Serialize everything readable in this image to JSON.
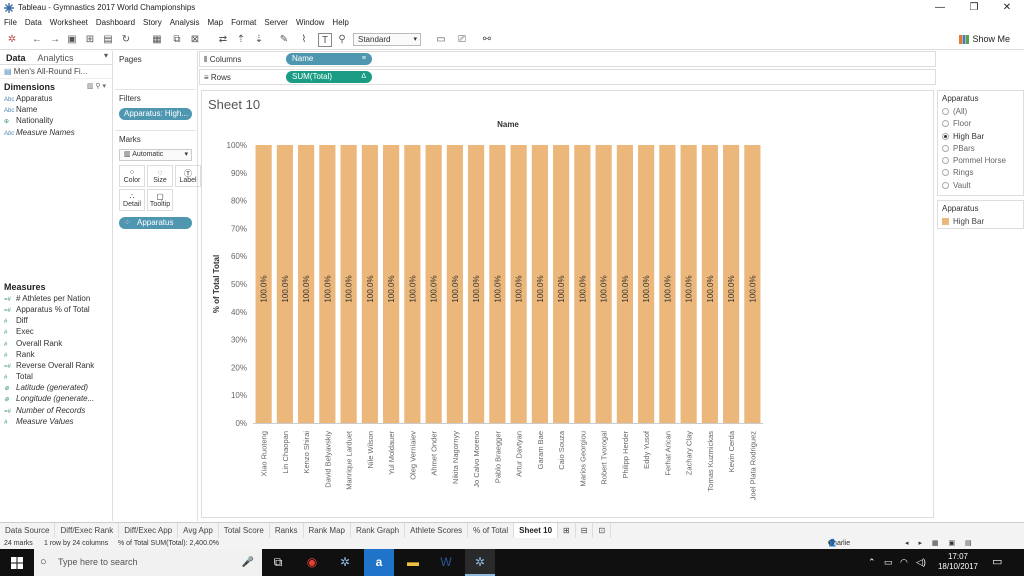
{
  "window": {
    "title": "Tableau - Gymnastics 2017 World Championships",
    "minimize": "—",
    "maximize": "❐",
    "close": "✕"
  },
  "menu": [
    "File",
    "Data",
    "Worksheet",
    "Dashboard",
    "Story",
    "Analysis",
    "Map",
    "Format",
    "Server",
    "Window",
    "Help"
  ],
  "toolbar": {
    "fit_select": "Standard",
    "show_me": "Show Me"
  },
  "data_pane": {
    "tabs": [
      "Data",
      "Analytics"
    ],
    "datasource": "Men's All-Round Fi...",
    "dimensions_header": "Dimensions",
    "dimensions": [
      {
        "type": "Abc",
        "name": "Apparatus",
        "italic": false
      },
      {
        "type": "Abc",
        "name": "Name",
        "italic": false
      },
      {
        "type": "⊕",
        "name": "Nationality",
        "italic": false
      },
      {
        "type": "Abc",
        "name": "Measure Names",
        "italic": true
      }
    ],
    "measures_header": "Measures",
    "measures": [
      {
        "type": "=#",
        "name": "# Athletes per Nation",
        "italic": false
      },
      {
        "type": "=#",
        "name": "Apparatus % of Total",
        "italic": false
      },
      {
        "type": "#",
        "name": "Diff",
        "italic": false
      },
      {
        "type": "#",
        "name": "Exec",
        "italic": false
      },
      {
        "type": "#",
        "name": "Overall Rank",
        "italic": false
      },
      {
        "type": "#",
        "name": "Rank",
        "italic": false
      },
      {
        "type": "=#",
        "name": "Reverse Overall Rank",
        "italic": false
      },
      {
        "type": "#",
        "name": "Total",
        "italic": false
      },
      {
        "type": "⊕",
        "name": "Latitude (generated)",
        "italic": true
      },
      {
        "type": "⊕",
        "name": "Longitude (generate...",
        "italic": true
      },
      {
        "type": "=#",
        "name": "Number of Records",
        "italic": true
      },
      {
        "type": "#",
        "name": "Measure Values",
        "italic": true
      }
    ]
  },
  "cards": {
    "pages": "Pages",
    "filters": "Filters",
    "filter_pill": "Apparatus: High...",
    "marks": "Marks",
    "mark_type": "Automatic",
    "mark_buttons": [
      {
        "icon": "⁘",
        "label": "Color"
      },
      {
        "icon": "◌",
        "label": "Size"
      },
      {
        "icon": "Ⓣ",
        "label": "Label"
      },
      {
        "icon": "∴",
        "label": "Detail"
      },
      {
        "icon": "▢",
        "label": "Tooltip"
      }
    ],
    "color_pill": "Apparatus"
  },
  "shelves": {
    "columns_label": "Columns",
    "columns_pill": "Name",
    "rows_label": "Rows",
    "rows_pill": "SUM(Total)",
    "rows_pill_mark": "Δ"
  },
  "sheet": {
    "title": "Sheet 10"
  },
  "chart_data": {
    "type": "bar",
    "header": "Name",
    "ylabel": "% of Total Total",
    "ylim": [
      0,
      100
    ],
    "yticks": [
      "0%",
      "10%",
      "20%",
      "30%",
      "40%",
      "50%",
      "60%",
      "70%",
      "80%",
      "90%",
      "100%"
    ],
    "bar_color": "#ebb77b",
    "bar_label": "100.0%",
    "categories": [
      "Xiao Ruoteng",
      "Lin Chaopan",
      "Kenzo Shirai",
      "David Belyavskiy",
      "Manrique Larduet",
      "Nile Wilson",
      "Yul Moldauer",
      "Oleg Verniaiev",
      "Ahmet Onder",
      "Nikita Nagornyy",
      "Jo Calvo Moreno",
      "Pablo Braegger",
      "Artur Davtyan",
      "Garam Bae",
      "Caio Souza",
      "Marios Georgiou",
      "Robert Tvorogal",
      "Philipp Herder",
      "Eddy Yusof",
      "Ferhat Arican",
      "Zachary Clay",
      "Tomas Kuzmickas",
      "Kevin Cerda",
      "Joel Plata Rodriguez"
    ],
    "values": [
      100,
      100,
      100,
      100,
      100,
      100,
      100,
      100,
      100,
      100,
      100,
      100,
      100,
      100,
      100,
      100,
      100,
      100,
      100,
      100,
      100,
      100,
      100,
      100
    ]
  },
  "filter_card": {
    "title": "Apparatus",
    "options": [
      "(All)",
      "Floor",
      "High Bar",
      "PBars",
      "Pommel Horse",
      "Rings",
      "Vault"
    ],
    "selected": "High Bar"
  },
  "legend": {
    "title": "Apparatus",
    "items": [
      {
        "label": "High Bar",
        "color": "#ebb77b"
      }
    ]
  },
  "sheet_tabs": [
    "Data Source",
    "Diff/Exec Rank",
    "Diff/Exec App",
    "Avg App",
    "Total Score",
    "Ranks",
    "Rank Map",
    "Rank Graph",
    "Athlete Scores",
    "% of Total",
    "Sheet 10"
  ],
  "active_tab": "Sheet 10",
  "status": {
    "marks": "24 marks",
    "dims": "1 row by 24 columns",
    "sum": "% of Total SUM(Total): 2,400.0%",
    "user": "Charlie Daf..."
  },
  "taskbar": {
    "search_placeholder": "Type here to search",
    "time": "17:07",
    "date": "18/10/2017"
  }
}
